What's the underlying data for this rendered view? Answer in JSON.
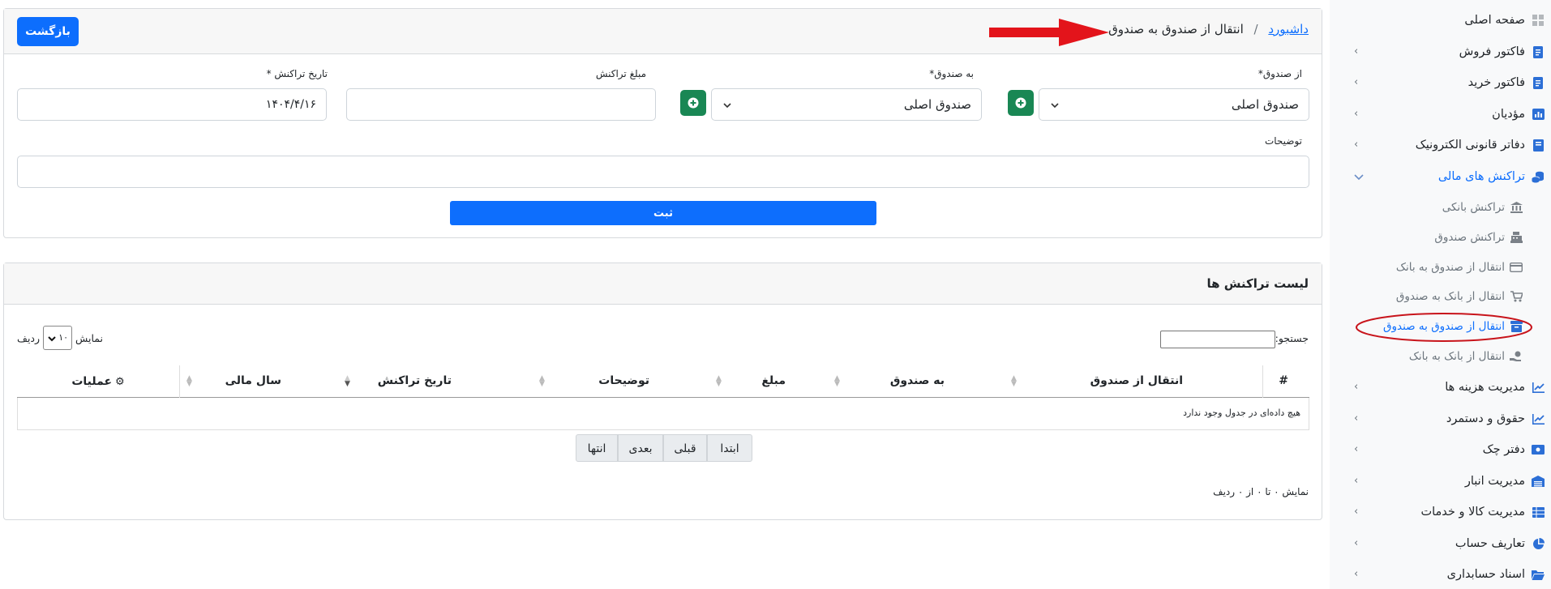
{
  "sidebar": {
    "items": [
      {
        "label": "صفحه اصلی",
        "icon": "grid-icon",
        "has_chevron": false
      },
      {
        "label": "فاکتور فروش",
        "icon": "invoice-icon",
        "has_chevron": true
      },
      {
        "label": "فاکتور خرید",
        "icon": "invoice-icon",
        "has_chevron": true
      },
      {
        "label": "مؤدیان",
        "icon": "chart-bar-icon",
        "has_chevron": true
      },
      {
        "label": "دفاتر قانونی الکترونیک",
        "icon": "book-icon",
        "has_chevron": true
      },
      {
        "label": "تراکنش های مالی",
        "icon": "coins-icon",
        "has_chevron": true,
        "active": true
      },
      {
        "label": "مدیریت هزینه ها",
        "icon": "chart-line-icon",
        "has_chevron": true
      },
      {
        "label": "حقوق و دستمرد",
        "icon": "chart-line-icon",
        "has_chevron": true
      },
      {
        "label": "دفتر چک",
        "icon": "money-icon",
        "has_chevron": true
      },
      {
        "label": "مدیریت انبار",
        "icon": "warehouse-icon",
        "has_chevron": true
      },
      {
        "label": "مدیریت کالا و خدمات",
        "icon": "table-icon",
        "has_chevron": true
      },
      {
        "label": "تعاریف حساب",
        "icon": "pie-chart-icon",
        "has_chevron": true
      },
      {
        "label": "اسناد حسابداری",
        "icon": "folder-icon",
        "has_chevron": true
      }
    ],
    "sub_items": [
      {
        "label": "تراکنش بانکی",
        "icon": "bank-icon"
      },
      {
        "label": "تراکنش صندوق",
        "icon": "cash-register-icon"
      },
      {
        "label": "انتقال از صندوق به بانک",
        "icon": "credit-card-icon"
      },
      {
        "label": "انتقال از بانک به صندوق",
        "icon": "cart-icon"
      },
      {
        "label": "انتقال از صندوق به صندوق",
        "icon": "box-icon",
        "active": true
      },
      {
        "label": "انتقال از بانک به بانک",
        "icon": "hand-coins-icon"
      }
    ]
  },
  "header": {
    "breadcrumb_link": "داشبورد",
    "separator": "/",
    "current": "انتقال از صندوق به صندوق",
    "back_label": "بازگشت"
  },
  "form": {
    "from_fund_label": "از صندوق*",
    "from_fund_value": "صندوق اصلی",
    "to_fund_label": "به صندوق*",
    "to_fund_value": "صندوق اصلی",
    "amount_label": "مبلغ تراکنش",
    "amount_value": "",
    "date_label": "تاریخ تراکنش *",
    "date_value": "۱۴۰۴/۴/۱۶",
    "description_label": "توضیحات",
    "description_value": "",
    "submit_label": "ثبت"
  },
  "list": {
    "title": "لیست تراکنش ها",
    "search_label": "جستجو:",
    "search_value": "",
    "show_label": "نمایش",
    "rows_label": "ردیف",
    "page_size": "۱۰",
    "columns": [
      "#",
      "انتقال از صندوق",
      "به صندوق",
      "مبلغ",
      "توضیحات",
      "تاریخ تراکنش",
      "سال مالی",
      "عملیات"
    ],
    "empty_message": "هیچ داده‌ای در جدول وجود ندارد",
    "pager": {
      "first": "ابتدا",
      "prev": "قبلی",
      "next": "بعدی",
      "last": "انتها"
    },
    "info": "نمایش ۰ تا ۰ از ۰ ردیف"
  },
  "colors": {
    "primary": "#0d6efd",
    "success": "#198754",
    "annotation_red": "#e3141b"
  }
}
